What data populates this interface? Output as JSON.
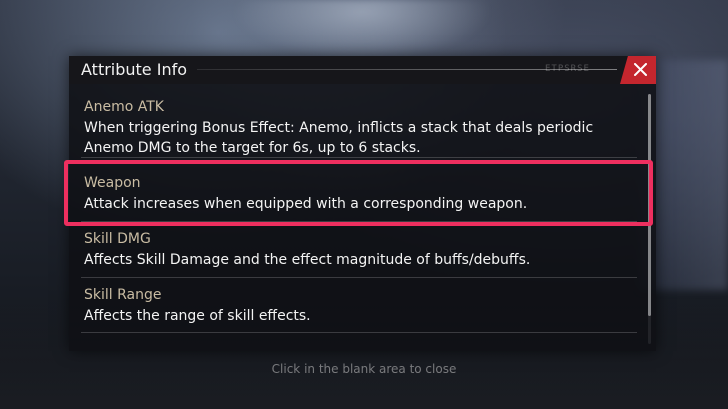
{
  "dialog": {
    "title": "Attribute Info",
    "header_tag": "ETPSRSE",
    "close_icon": "close-icon",
    "accent_color": "#c4262e"
  },
  "attributes": [
    {
      "label": "Anemo ATK",
      "description_lines": [
        "When triggering Bonus Effect: Anemo, inflicts a stack that deals periodic",
        "Anemo DMG to the target for 6s, up to 6 stacks."
      ]
    },
    {
      "label": "Weapon",
      "description_lines": [
        "Attack increases when equipped with a corresponding weapon."
      ],
      "highlighted": true
    },
    {
      "label": "Skill DMG",
      "description_lines": [
        "Affects Skill Damage and the effect magnitude of buffs/debuffs."
      ]
    },
    {
      "label": "Skill Range",
      "description_lines": [
        "Affects the range of skill effects."
      ]
    }
  ],
  "highlight_color": "#ee2f5f",
  "footer": {
    "close_hint": "Click in the blank area to close"
  }
}
